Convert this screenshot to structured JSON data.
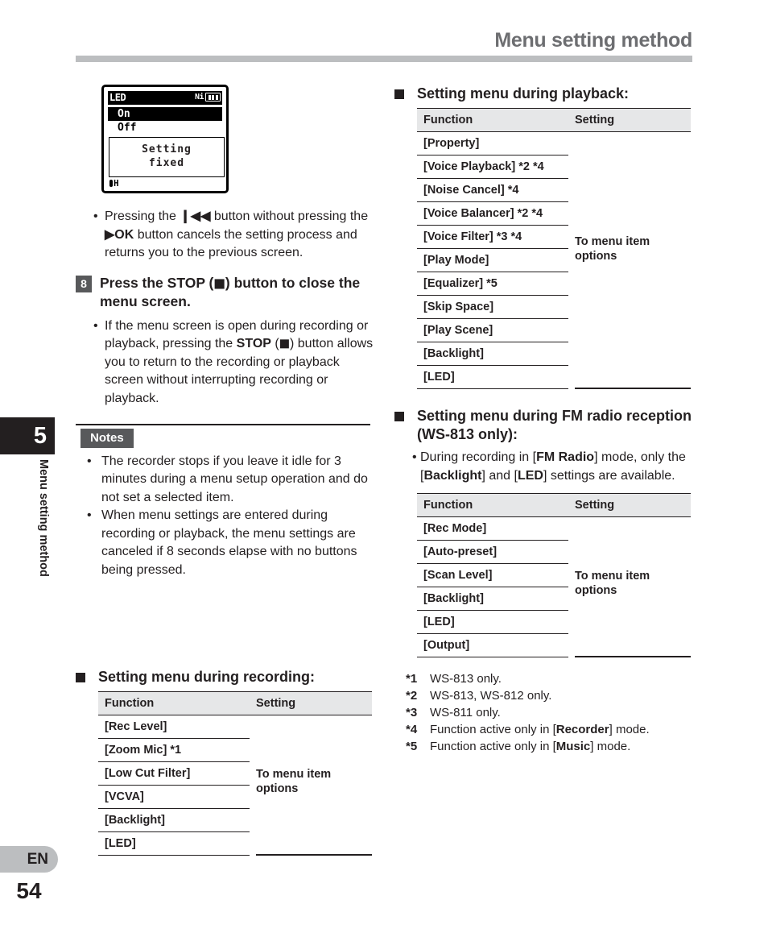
{
  "header": {
    "title": "Menu setting method"
  },
  "sidebar": {
    "chapter_number": "5",
    "chapter_label": "Menu setting method",
    "language_badge": "EN",
    "page_number": "54",
    "colors": {
      "chapter_box": "#231f20",
      "badge": "#bcbec0",
      "rule": "#bcbec0"
    }
  },
  "lcd": {
    "title": "LED",
    "battery_label": "Ni",
    "battery_icon": "battery-full-icon",
    "selected_item": "On",
    "normal_item": "Off",
    "dialog_line1": "Setting",
    "dialog_line2": "fixed",
    "foot_icon_label": "H"
  },
  "left_column": {
    "bullet_before_step": "Pressing the ❙◀◀ button without pressing the ▶OK button cancels the setting process and returns you to the previous screen.",
    "step": {
      "number": "8",
      "text": "Press the STOP (◼) button to close the menu screen."
    },
    "step_bullet": "If the menu screen is open during recording or playback, pressing the STOP (◼) button allows you to return to the recording or playback screen without interrupting recording or playback.",
    "notes_label": "Notes",
    "notes": [
      "The recorder stops if you leave it idle for 3 minutes during a menu setup operation and do not set a selected item.",
      "When menu settings are entered during recording or playback, the menu settings are canceled if 8 seconds elapse with no buttons being pressed."
    ],
    "recording_table": {
      "heading": "Setting menu during recording:",
      "columns": [
        "Function",
        "Setting"
      ],
      "setting_value": "To menu item options",
      "rows": [
        "[Rec Level]",
        "[Zoom Mic] *1",
        "[Low Cut Filter]",
        "[VCVA]",
        "[Backlight]",
        "[LED]"
      ]
    }
  },
  "right_column": {
    "playback_table": {
      "heading": "Setting menu during playback:",
      "columns": [
        "Function",
        "Setting"
      ],
      "setting_value": "To menu item options",
      "rows": [
        "[Property]",
        "[Voice Playback] *2 *4",
        "[Noise Cancel] *4",
        "[Voice Balancer] *2 *4",
        "[Voice Filter] *3 *4",
        "[Play Mode]",
        "[Equalizer] *5",
        "[Skip Space]",
        "[Play Scene]",
        "[Backlight]",
        "[LED]"
      ]
    },
    "fm_section": {
      "heading": "Setting menu during FM radio reception (WS-813 only):",
      "bullet": "During recording in [FM Radio] mode, only the [Backlight] and [LED] settings are available.",
      "columns": [
        "Function",
        "Setting"
      ],
      "setting_value": "To menu item options",
      "rows": [
        "[Rec Mode]",
        "[Auto-preset]",
        "[Scan Level]",
        "[Backlight]",
        "[LED]",
        "[Output]"
      ]
    },
    "footnotes": [
      {
        "marker": "*1",
        "text": "WS-813 only."
      },
      {
        "marker": "*2",
        "text": "WS-813, WS-812 only."
      },
      {
        "marker": "*3",
        "text": "WS-811 only."
      },
      {
        "marker": "*4",
        "text": "Function active only in [Recorder] mode."
      },
      {
        "marker": "*5",
        "text": "Function active only in [Music] mode."
      }
    ]
  }
}
